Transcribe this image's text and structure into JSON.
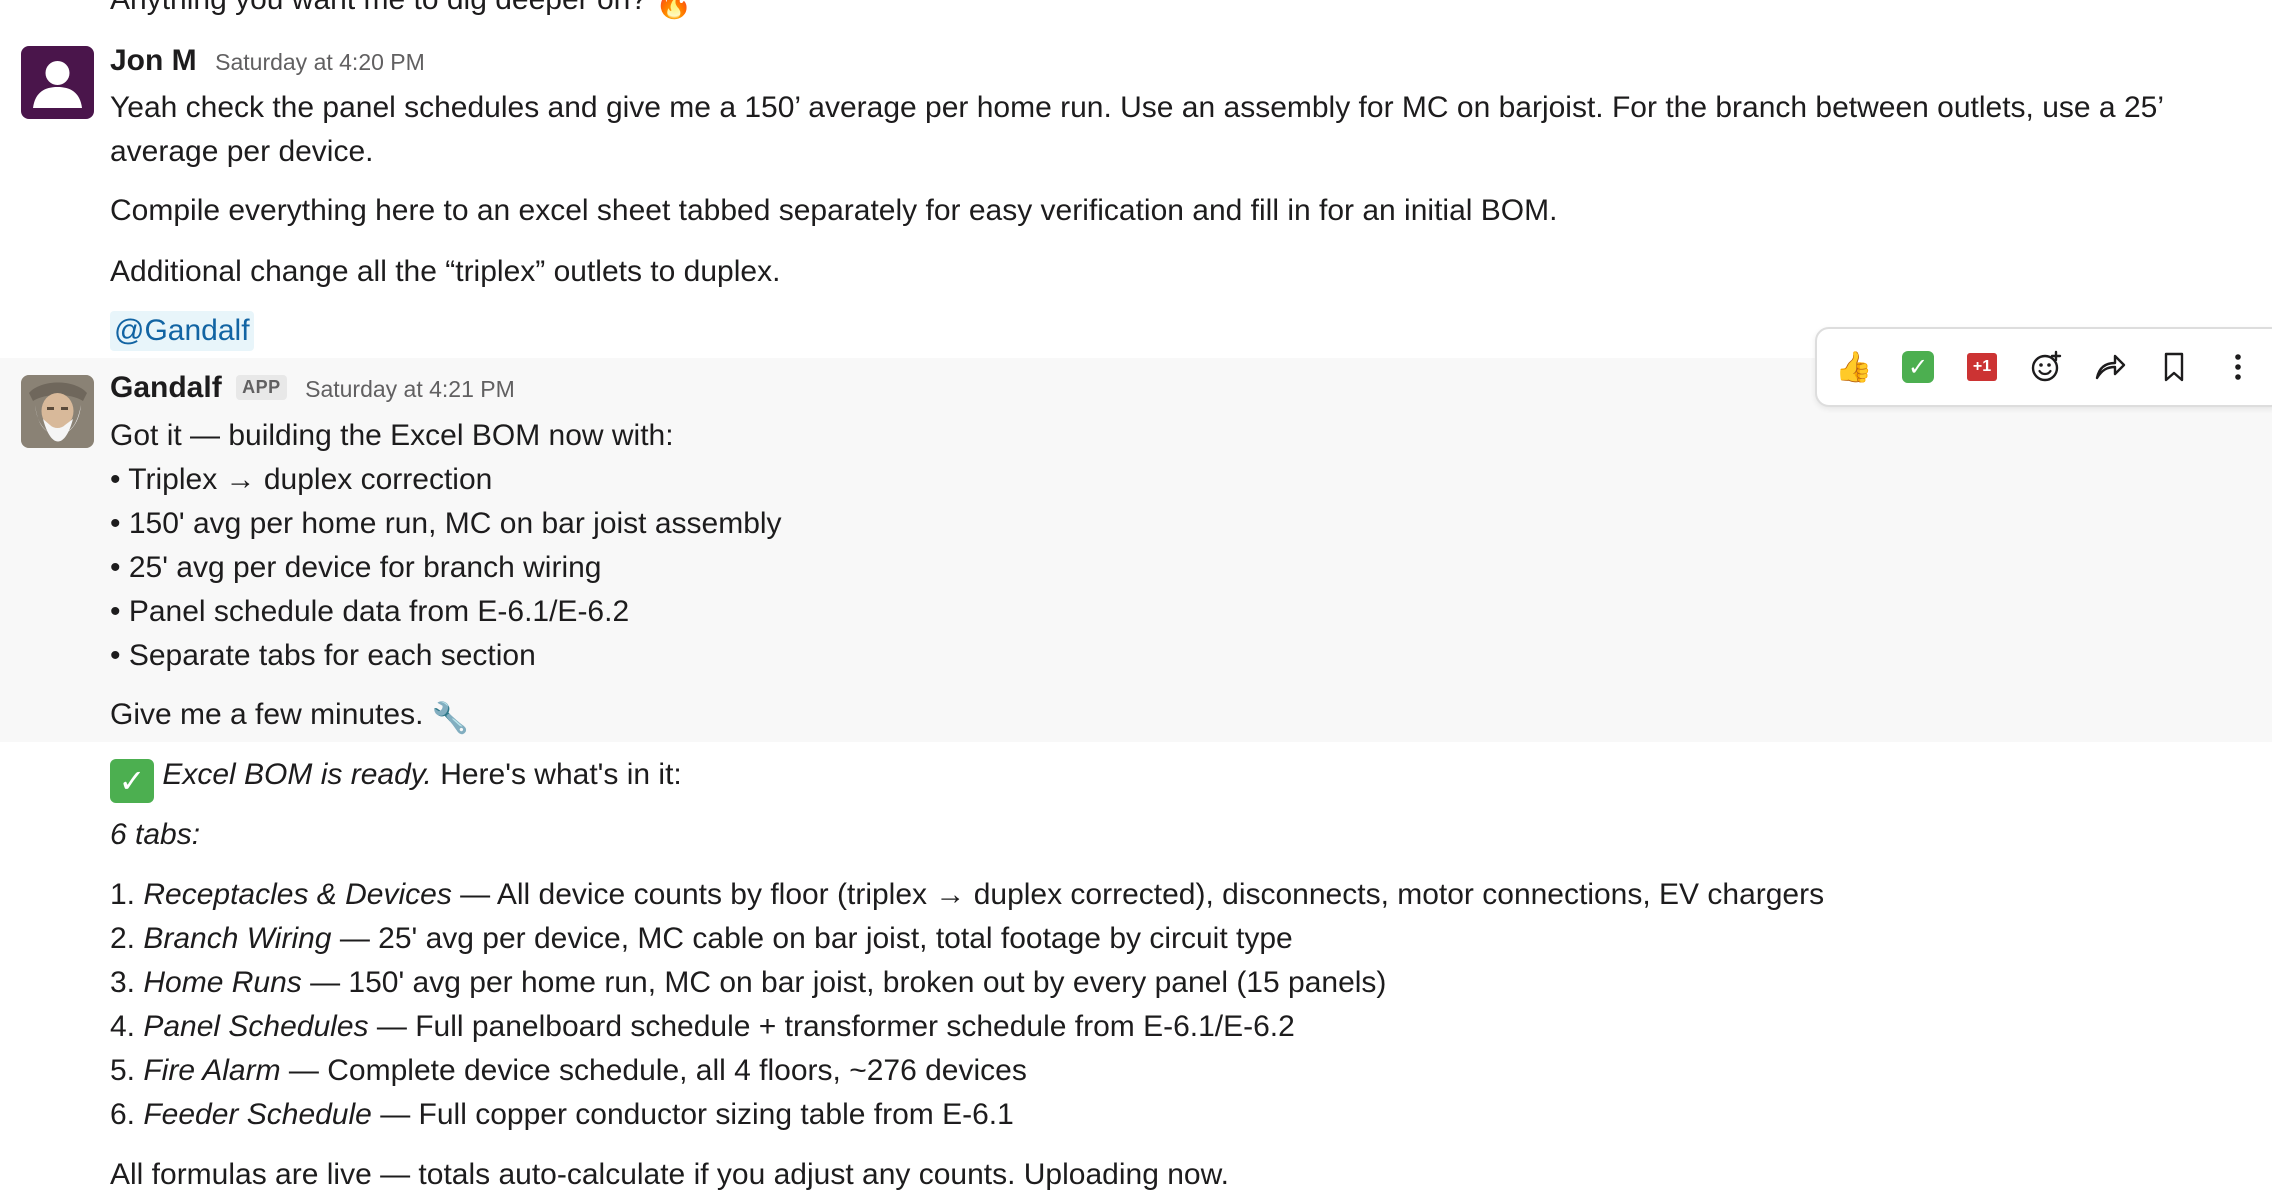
{
  "previous_message": {
    "text": "Anything you want me to dig deeper on?",
    "emoji": "🔥"
  },
  "jon": {
    "author": "Jon M",
    "timestamp": "Saturday at 4:20 PM",
    "paragraph1": "Yeah check the panel schedules and give me a 150’ average per home run. Use an assembly for MC on barjoist. For the branch between outlets, use a 25’ average per device.",
    "paragraph2": "Compile everything here to an excel sheet tabbed separately for easy verification and fill in for an initial BOM.",
    "paragraph3": "Additional change all the “triplex” outlets to duplex.",
    "mention": "@Gandalf"
  },
  "gandalf": {
    "author": "Gandalf",
    "badge": "APP",
    "timestamp": "Saturday at 4:21 PM",
    "intro": "Got it — building the Excel BOM now with:",
    "bullets": [
      "Triplex → duplex correction",
      "150' avg per home run, MC on bar joist assembly",
      "25' avg per device for branch wiring",
      "Panel schedule data from E-6.1/E-6.2",
      "Separate tabs for each section"
    ],
    "few_minutes": "Give me a few minutes.",
    "few_minutes_emoji": "🔧",
    "ready_emph": "Excel BOM is ready.",
    "ready_rest": " Here's what's in it:",
    "tabs_heading": "6 tabs:",
    "tabs": [
      {
        "num": "1. ",
        "name": "Receptacles & Devices",
        "desc": " — All device counts by floor (triplex → duplex corrected), disconnects, motor connections, EV chargers"
      },
      {
        "num": "2. ",
        "name": "Branch Wiring",
        "desc": " — 25' avg per device, MC cable on bar joist, total footage by circuit type"
      },
      {
        "num": "3. ",
        "name": "Home Runs",
        "desc": " — 150' avg per home run, MC on bar joist, broken out by every panel (15 panels)"
      },
      {
        "num": "4. ",
        "name": "Panel Schedules",
        "desc": " — Full panelboard schedule + transformer schedule from E-6.1/E-6.2"
      },
      {
        "num": "5. ",
        "name": "Fire Alarm",
        "desc": " — Complete device schedule, all 4 floors, ~276 devices"
      },
      {
        "num": "6. ",
        "name": "Feeder Schedule",
        "desc": " — Full copper conductor sizing table from E-6.1"
      }
    ],
    "closing": "All formulas are live — totals auto-calculate if you adjust any counts. Uploading now."
  },
  "toolbar": {
    "thumbs_up": "👍",
    "check": "✓",
    "plus_one": "+1",
    "icons": [
      "thumbs-up-icon",
      "check-mark-icon",
      "plus-one-icon",
      "add-reaction-icon",
      "share-icon",
      "bookmark-icon",
      "more-actions-icon"
    ]
  },
  "colors": {
    "accent": "#1264a3",
    "mention_bg": "#e8f5fa",
    "hover_bg": "#f8f8f8",
    "jon_avatar": "#4a154b"
  }
}
